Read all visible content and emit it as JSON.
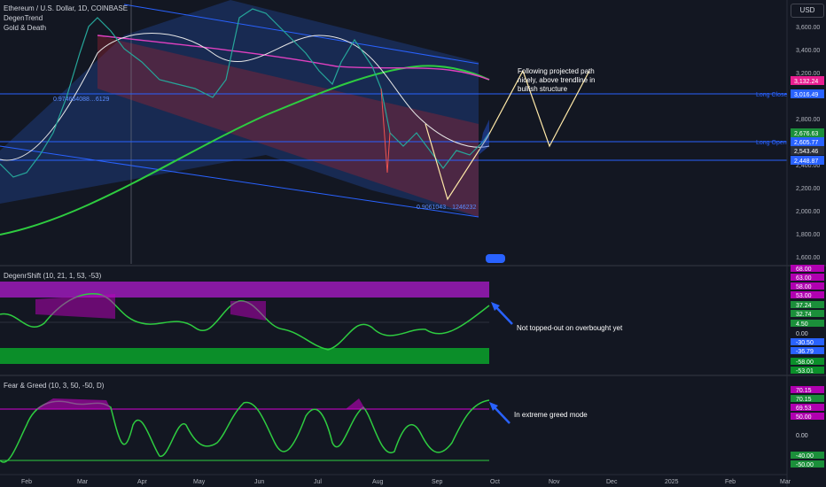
{
  "header": {
    "title": "Ethereum / U.S. Dollar, 1D, COINBASE",
    "indicators": [
      "DegenTrend",
      "Gold & Death"
    ],
    "currency_button": "USD"
  },
  "pane_labels": {
    "degenshift": "DegenrShift (10, 21, 1, 53, -53)",
    "fear_greed": "Fear & Greed (10, 3, 50, -50, D)"
  },
  "price_axis": [
    "3,600.00",
    "3,400.00",
    "3,200.00",
    "2,800.00",
    "2,400.00",
    "2,200.00",
    "2,000.00",
    "1,800.00",
    "1,600.00"
  ],
  "price_tags": [
    {
      "text": "3,132.24",
      "color": "#e91e90"
    },
    {
      "text": "3,016.49",
      "color": "#2962ff"
    },
    {
      "text": "2,676.63",
      "color": "#1b8f3a"
    },
    {
      "text": "2,605.77",
      "color": "#2962ff"
    },
    {
      "text": "2,543.46",
      "color": "#2a2e39"
    },
    {
      "text": "2,448.87",
      "color": "#2962ff"
    }
  ],
  "line_labels": {
    "long_close": "Long Close",
    "long_open": "Long Open",
    "fib_top": "0.974664088…6129",
    "fib_bottom": "0.9061043…1246232"
  },
  "degen_axis": {
    "tags": [
      {
        "text": "68.00",
        "color": "#b000b0"
      },
      {
        "text": "63.00",
        "color": "#b000b0"
      },
      {
        "text": "58.00",
        "color": "#b000b0"
      },
      {
        "text": "53.00",
        "color": "#b000b0"
      },
      {
        "text": "37.24",
        "color": "#1b8f3a"
      },
      {
        "text": "32.74",
        "color": "#1b8f3a"
      },
      {
        "text": "4.50",
        "color": "#1b8f3a"
      },
      {
        "text": "0.00",
        "color": "#131722"
      },
      {
        "text": "-30.50",
        "color": "#2962ff"
      },
      {
        "text": "-36.79",
        "color": "#2962ff"
      },
      {
        "text": "-58.00",
        "color": "#0b8f2a"
      },
      {
        "text": "-53.01",
        "color": "#0b8f2a"
      }
    ]
  },
  "fg_axis": {
    "tags": [
      {
        "text": "70.15",
        "color": "#b000b0"
      },
      {
        "text": "70.15",
        "color": "#1b8f3a"
      },
      {
        "text": "69.53",
        "color": "#b000b0"
      },
      {
        "text": "50.00",
        "color": "#b000b0"
      },
      {
        "text": "0.00",
        "color": "#131722"
      },
      {
        "text": "-40.00",
        "color": "#1b8f3a"
      },
      {
        "text": "-50.00",
        "color": "#1b8f3a"
      }
    ]
  },
  "time_axis": [
    "Feb",
    "Mar",
    "Apr",
    "May",
    "Jun",
    "Jul",
    "Aug",
    "Sep",
    "Oct",
    "Nov",
    "Dec",
    "2025",
    "Feb",
    "Mar"
  ],
  "annotations": {
    "projection": "Following projected path nicely, above trendline in bullish structure",
    "overbought": "Not topped-out on overbought yet",
    "greed": "In extreme greed mode"
  },
  "colors": {
    "background": "#131722",
    "up": "#26a69a",
    "down": "#ef5350",
    "accent_blue": "#2962ff",
    "magenta": "#d600d6",
    "green": "#2ecc40"
  }
}
